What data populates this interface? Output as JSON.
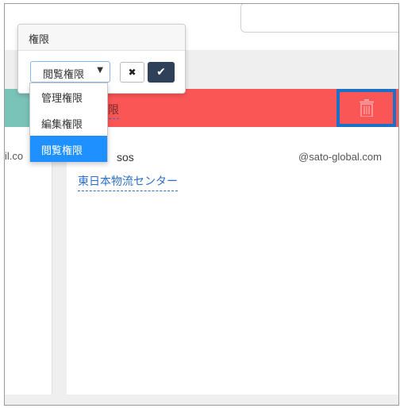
{
  "popover": {
    "title": "権限",
    "select_value": "閲覧権限",
    "select_arrow": "▼",
    "cancel_glyph": "✖",
    "ok_glyph": "✔"
  },
  "dropdown": {
    "options": [
      "管理権限",
      "編集権限",
      "閲覧権限"
    ],
    "selected_index": 2
  },
  "left_card": {
    "email_fragment": "il.co"
  },
  "right_card": {
    "header_role_fragment": "権限",
    "user_name": "sos",
    "email": "@sato-global.com",
    "company": "東日本物流センター"
  },
  "colors": {
    "header_red": "#fb5656",
    "header_teal": "#79c3b8",
    "highlight_blue": "#1b71c8",
    "selected_option": "#1e90ff",
    "ok_button": "#2f4159"
  },
  "icons": {
    "delete": "trash-icon",
    "cancel": "close-icon",
    "confirm": "check-icon"
  }
}
